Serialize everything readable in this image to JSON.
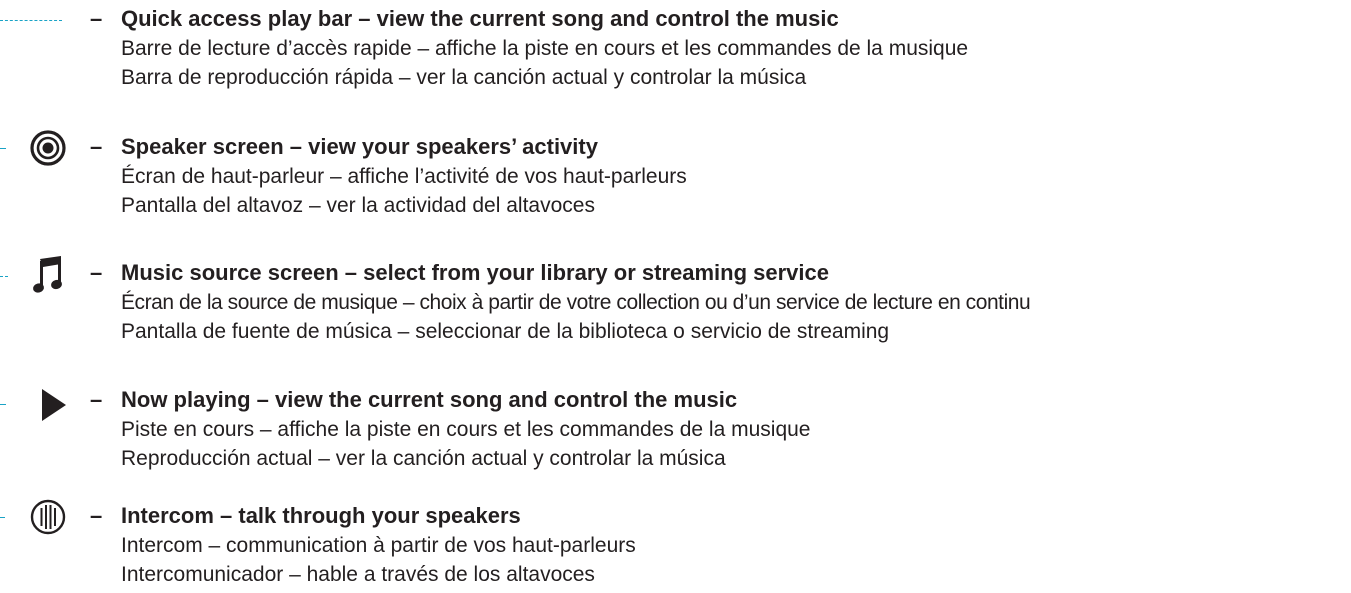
{
  "items": [
    {
      "icon": "dashed-leader",
      "title": "Quick access play bar – view the current song and control the music",
      "fr": "Barre de lecture d’accès rapide – affiche la piste en cours et les commandes de la musique",
      "es": "Barra de reproducción rápida  – ver la canción actual y controlar la música"
    },
    {
      "icon": "speaker-icon",
      "title": "Speaker screen – view your speakers’ activity",
      "fr": "Écran de haut-parleur – affiche l’activité de vos haut-parleurs",
      "es": "Pantalla del altavoz – ver la actividad del altavoces"
    },
    {
      "icon": "music-note-icon",
      "title": "Music source screen – select from your library or streaming service",
      "fr": "Écran de la source de musique – choix à partir de votre collection ou d’un service de lecture en continu",
      "es": "Pantalla de fuente de música – seleccionar de la biblioteca o servicio de streaming"
    },
    {
      "icon": "play-icon",
      "title": "Now playing – view the current song and control the music",
      "fr": "Piste en cours – affiche la piste en cours et les commandes de la musique",
      "es": "Reproducción actual – ver la canción actual y controlar la música"
    },
    {
      "icon": "intercom-icon",
      "title": "Intercom – talk through your speakers",
      "fr": "Intercom – communication à partir de vos haut-parleurs",
      "es": "Intercomunicador – hable a través de los altavoces"
    }
  ],
  "separator": "–",
  "accent_color": "#1aa3c6",
  "text_color": "#231f20"
}
